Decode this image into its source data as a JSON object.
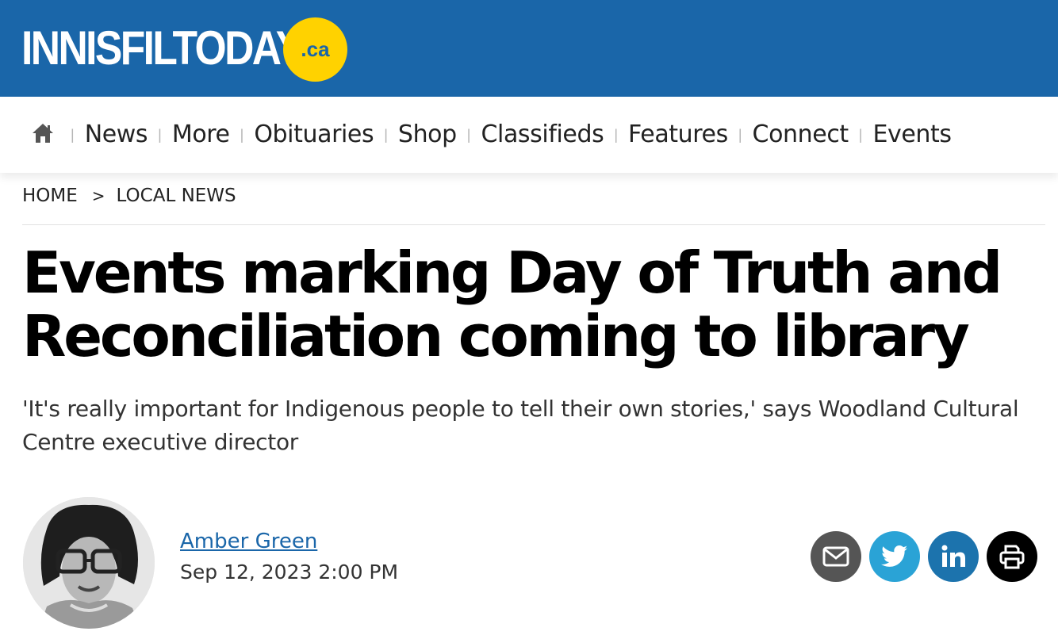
{
  "site": {
    "logo_text": "INNISFILTODAY",
    "logo_suffix": ".ca",
    "brand_color": "#1a66a9",
    "accent_color": "#ffd200"
  },
  "nav": {
    "home_icon": "home-icon",
    "items": [
      "News",
      "More",
      "Obituaries",
      "Shop",
      "Classifieds",
      "Features",
      "Connect",
      "Events"
    ]
  },
  "breadcrumb": {
    "home": "HOME",
    "separator": ">",
    "section": "LOCAL NEWS"
  },
  "article": {
    "headline": "Events marking Day of Truth and Reconciliation coming to library",
    "subhead": "'It's really important for Indigenous people to tell their own stories,' says Woodland Cultural Centre executive director",
    "author": "Amber Green",
    "date": "Sep 12, 2023 2:00 PM"
  },
  "share": [
    {
      "name": "email",
      "icon": "mail-icon",
      "color": "#555555"
    },
    {
      "name": "twitter",
      "icon": "twitter-icon",
      "color": "#2aa3d6"
    },
    {
      "name": "linkedin",
      "icon": "linkedin-icon",
      "color": "#1c73ad"
    },
    {
      "name": "print",
      "icon": "print-icon",
      "color": "#000000"
    }
  ]
}
